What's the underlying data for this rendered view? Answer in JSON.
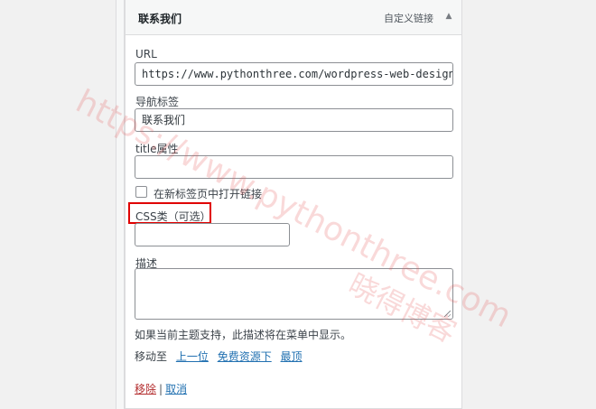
{
  "item": {
    "title": "联系我们",
    "type_label": "自定义链接",
    "toggle_glyph": "▲"
  },
  "fields": {
    "url_label": "URL",
    "url_value": "https://www.pythonthree.com/wordpress-web-design/",
    "nav_label": "导航标签",
    "nav_value": "联系我们",
    "title_attr_label": "title属性",
    "title_attr_value": "",
    "new_tab_label": "在新标签页中打开链接",
    "css_label": "CSS类（可选）",
    "css_value": "",
    "desc_label": "描述",
    "desc_value": "",
    "desc_help": "如果当前主题支持，此描述将在菜单中显示。"
  },
  "move": {
    "label": "移动至",
    "up_one": "上一位",
    "under": "免费资源下",
    "top": "最顶"
  },
  "actions": {
    "remove": "移除",
    "separator": "|",
    "cancel": "取消"
  },
  "watermark": {
    "url": "https://www.pythonthree.com",
    "brand": "晓得博客"
  },
  "colors": {
    "link": "#2271b1",
    "remove": "#b32d2e",
    "highlight": "#e00000"
  }
}
